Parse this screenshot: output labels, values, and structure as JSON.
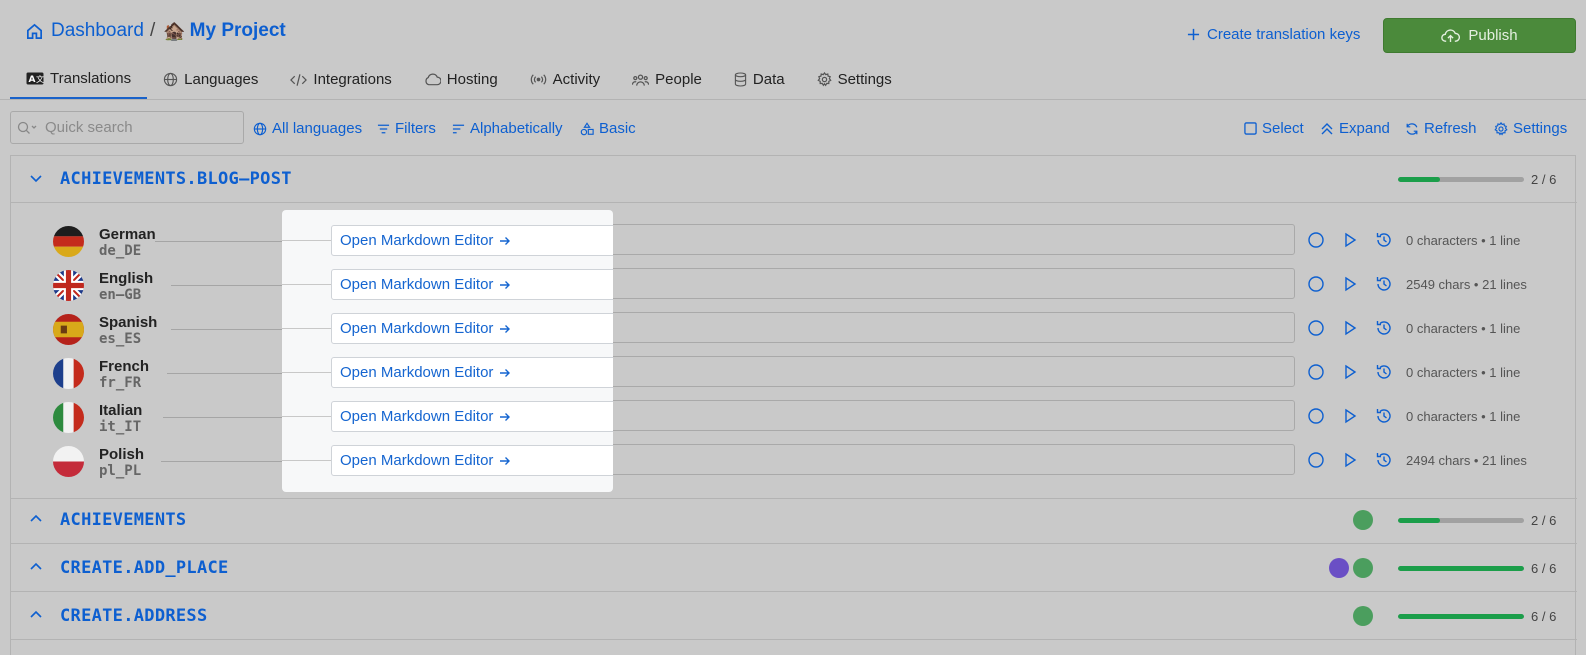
{
  "breadcrumb": {
    "home": "Dashboard",
    "separator": "/",
    "project_emoji": "🏚️",
    "project": "My Project"
  },
  "header": {
    "create_keys": "Create translation keys",
    "publish": "Publish"
  },
  "tabs": [
    {
      "label": "Translations",
      "icon": "translate-icon",
      "active": true
    },
    {
      "label": "Languages",
      "icon": "globe-icon"
    },
    {
      "label": "Integrations",
      "icon": "code-icon"
    },
    {
      "label": "Hosting",
      "icon": "cloud-icon"
    },
    {
      "label": "Activity",
      "icon": "broadcast-icon"
    },
    {
      "label": "People",
      "icon": "people-icon"
    },
    {
      "label": "Data",
      "icon": "database-icon"
    },
    {
      "label": "Settings",
      "icon": "gear-icon"
    }
  ],
  "toolbar": {
    "search_placeholder": "Quick search",
    "all_languages": "All languages",
    "filters": "Filters",
    "sort": "Alphabetically",
    "view": "Basic",
    "select": "Select",
    "expand": "Expand",
    "refresh": "Refresh",
    "settings": "Settings"
  },
  "groups": [
    {
      "name": "ACHIEVEMENTS.BLOG–POST",
      "expanded": true,
      "count": "2 / 6",
      "progress": 0.33,
      "dots": []
    },
    {
      "name": "ACHIEVEMENTS",
      "expanded": false,
      "count": "2 / 6",
      "progress": 0.33,
      "dots": [
        "#4b9e5e"
      ]
    },
    {
      "name": "CREATE.ADD_PLACE",
      "expanded": false,
      "count": "6 / 6",
      "progress": 1.0,
      "dots": [
        "#6a4fc5",
        "#4b9e5e"
      ]
    },
    {
      "name": "CREATE.ADDRESS",
      "expanded": false,
      "count": "6 / 6",
      "progress": 1.0,
      "dots": [
        "#4b9e5e"
      ]
    }
  ],
  "rows": [
    {
      "lang": "German",
      "code": "de_DE",
      "button": "Open Markdown Editor",
      "meta": "0 characters • 1 line",
      "flag": "de-flag"
    },
    {
      "lang": "English",
      "code": "en–GB",
      "button": "Open Markdown Editor",
      "meta": "2549 chars • 21 lines",
      "flag": "gb-flag"
    },
    {
      "lang": "Spanish",
      "code": "es_ES",
      "button": "Open Markdown Editor",
      "meta": "0 characters • 1 line",
      "flag": "es-flag"
    },
    {
      "lang": "French",
      "code": "fr_FR",
      "button": "Open Markdown Editor",
      "meta": "0 characters • 1 line",
      "flag": "fr-flag"
    },
    {
      "lang": "Italian",
      "code": "it_IT",
      "button": "Open Markdown Editor",
      "meta": "0 characters • 1 line",
      "flag": "it-flag"
    },
    {
      "lang": "Polish",
      "code": "pl_PL",
      "button": "Open Markdown Editor",
      "meta": "2494 chars • 21 lines",
      "flag": "pl-flag"
    }
  ],
  "colors": {
    "accent": "#0d5fd0",
    "publish_bg": "#4b8a3b",
    "progress_fill": "#1b9e4a"
  }
}
